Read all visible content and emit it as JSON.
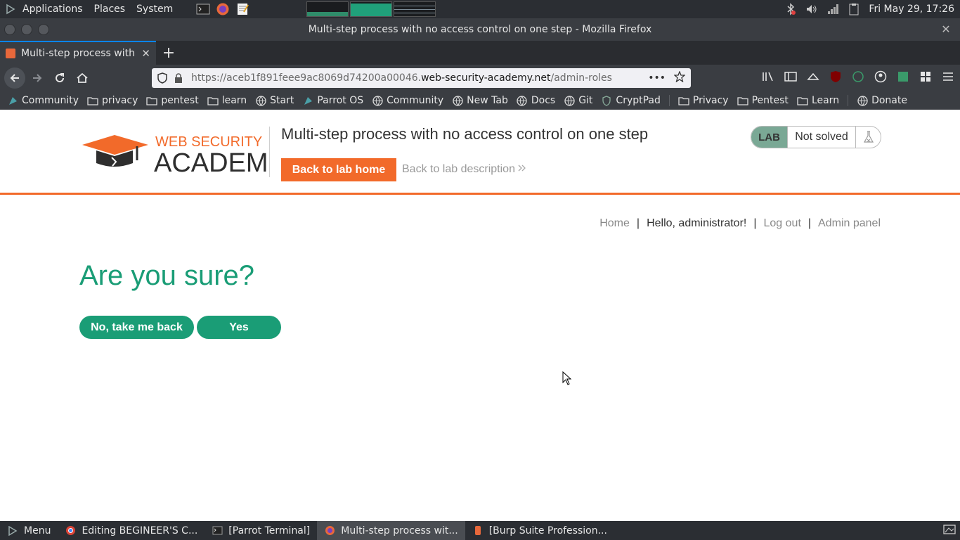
{
  "system_panel": {
    "menus": [
      "Applications",
      "Places",
      "System"
    ],
    "clock": "Fri May 29, 17:26"
  },
  "window": {
    "title": "Multi-step process with no access control on one step - Mozilla Firefox"
  },
  "browser": {
    "tab_title": "Multi-step process with no access control on one step",
    "url_prefix": "https://aceb1f891feee9ac8069d74200a00046.",
    "url_host": "web-security-academy.net",
    "url_path": "/admin-roles",
    "bookmarks": [
      {
        "label": "Community",
        "icon": "parrot-icon"
      },
      {
        "label": "privacy",
        "icon": "folder-icon"
      },
      {
        "label": "pentest",
        "icon": "folder-icon"
      },
      {
        "label": "learn",
        "icon": "folder-icon"
      },
      {
        "label": "Start",
        "icon": "globe-icon"
      },
      {
        "label": "Parrot OS",
        "icon": "parrot-icon"
      },
      {
        "label": "Community",
        "icon": "globe-icon"
      },
      {
        "label": "New Tab",
        "icon": "globe-icon"
      },
      {
        "label": "Docs",
        "icon": "globe-icon"
      },
      {
        "label": "Git",
        "icon": "globe-icon"
      },
      {
        "label": "CryptPad",
        "icon": "shield-icon"
      },
      {
        "label": "Privacy",
        "icon": "folder-icon"
      },
      {
        "label": "Pentest",
        "icon": "folder-icon"
      },
      {
        "label": "Learn",
        "icon": "folder-icon"
      },
      {
        "label": "Donate",
        "icon": "globe-icon"
      }
    ]
  },
  "academy": {
    "logo_line1": "WEB SECURITY",
    "logo_line2": "ACADEMY",
    "lab_title": "Multi-step process with no access control on one step",
    "back_home": "Back to lab home",
    "back_desc": "Back to lab description",
    "lab_badge": "LAB",
    "lab_state": "Not solved"
  },
  "nav_links": {
    "home": "Home",
    "greeting": "Hello, administrator!",
    "logout": "Log out",
    "admin": "Admin panel",
    "sep": "|"
  },
  "main": {
    "heading": "Are you sure?",
    "no_button": "No, take me back",
    "yes_button": "Yes"
  },
  "taskbar": {
    "menu": "Menu",
    "tasks": [
      {
        "label": "Editing BEGINEER'S C...",
        "icon": "chrome-icon",
        "active": false
      },
      {
        "label": "[Parrot Terminal]",
        "icon": "terminal-icon",
        "active": false
      },
      {
        "label": "Multi-step process wit...",
        "icon": "firefox-icon",
        "active": true
      },
      {
        "label": "[Burp Suite Profession...",
        "icon": "burp-icon",
        "active": false
      }
    ]
  },
  "colors": {
    "accent_orange": "#f26a2a",
    "accent_green": "#1a9d76"
  }
}
